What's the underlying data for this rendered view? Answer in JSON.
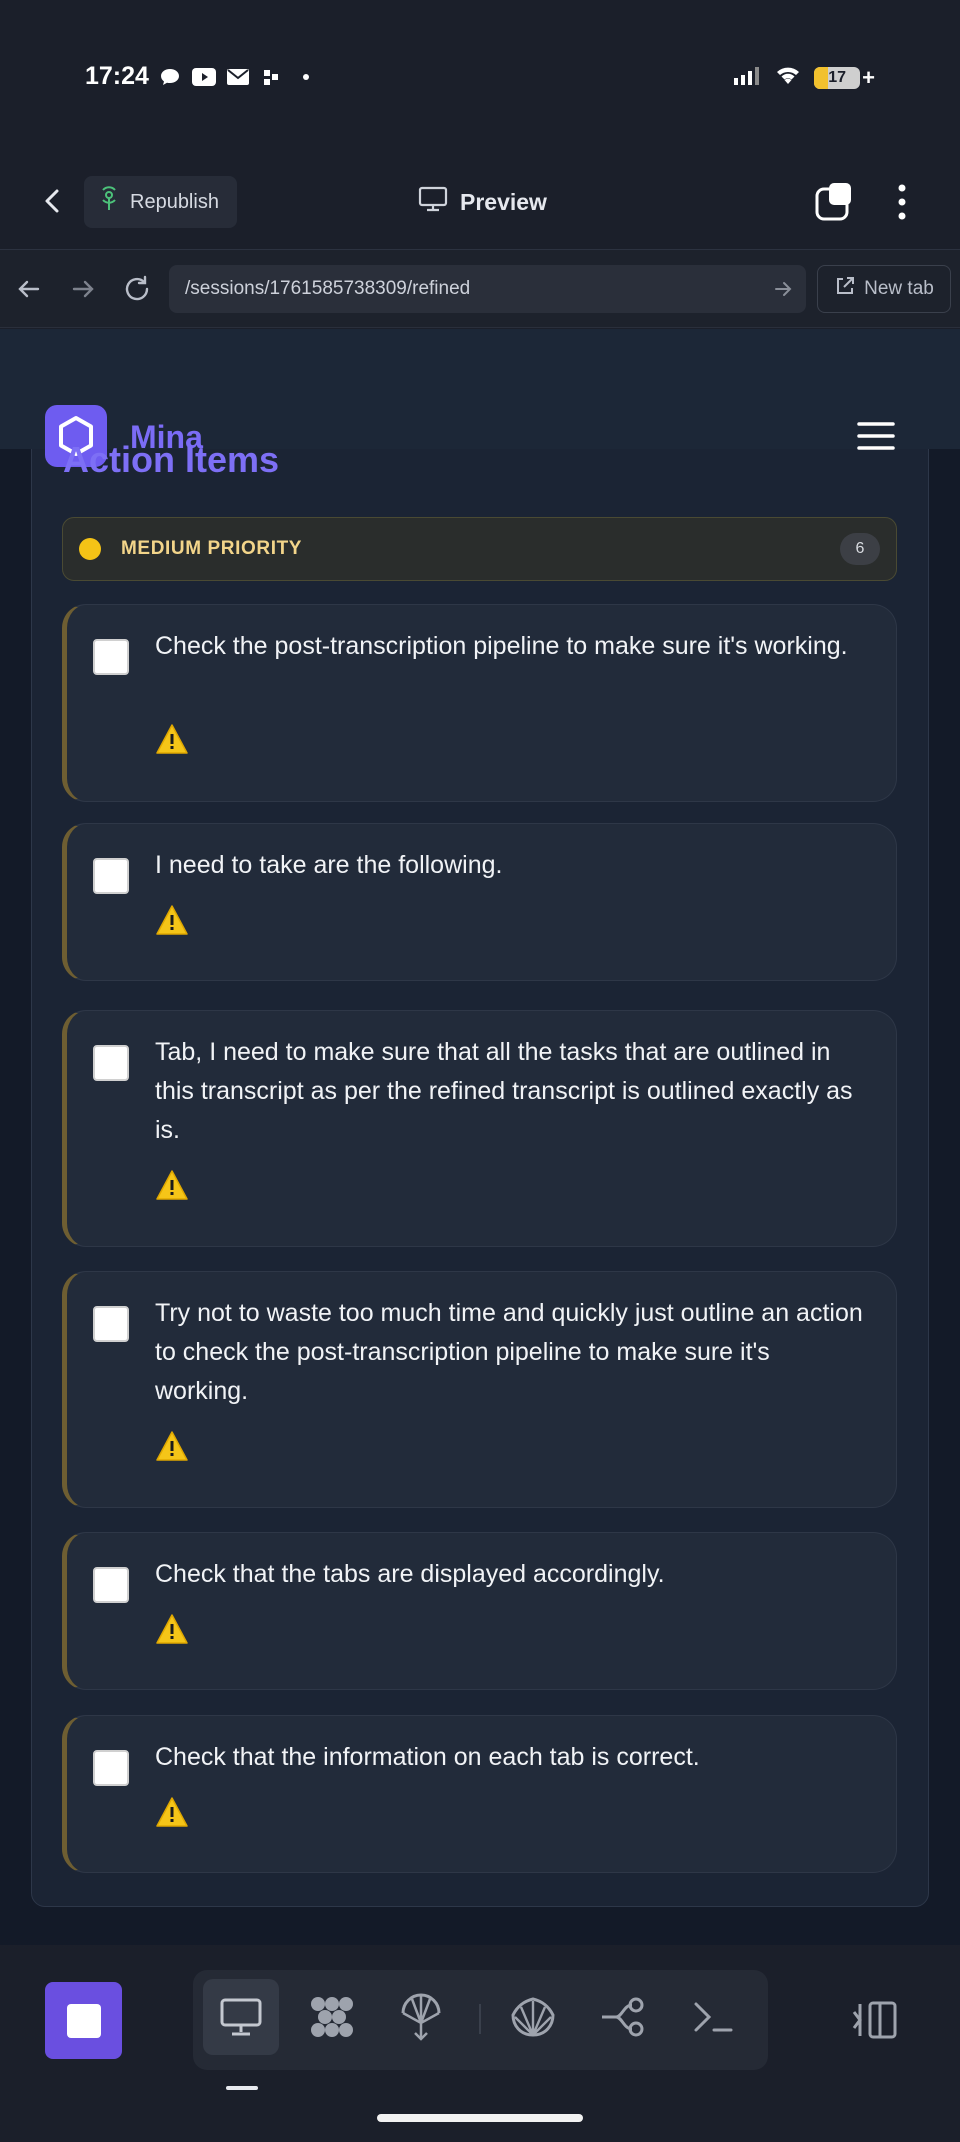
{
  "status_bar": {
    "time": "17:24",
    "battery": "17",
    "notification_icons": [
      "chat-bubble-icon",
      "youtube-icon",
      "mail-icon",
      "dots-icon"
    ]
  },
  "app_header": {
    "republish_label": "Republish",
    "preview_label": "Preview"
  },
  "url_bar": {
    "url": "/sessions/1761585738309/refined",
    "new_tab_label": "New tab"
  },
  "site": {
    "name": "Mina"
  },
  "section": {
    "title": "Action Items",
    "priority_label": "MEDIUM PRIORITY",
    "priority_count": "6",
    "colors": {
      "accent": "#7d6ff5",
      "priority_dot": "#f4c316",
      "priority_text": "#f3d58a"
    }
  },
  "items": [
    {
      "text": "Check the post-transcription pipeline to make sure it's working.",
      "checked": false,
      "icon": "warning-icon"
    },
    {
      "text": "I need to take are the following.",
      "checked": false,
      "icon": "warning-icon"
    },
    {
      "text": "Tab, I need to make sure that all the tasks that are outlined in this transcript as per the refined transcript is outlined exactly as is.",
      "checked": false,
      "icon": "warning-icon"
    },
    {
      "text": "Try not to waste too much time and quickly just outline an action to check the post-transcription pipeline to make sure it's working.",
      "checked": false,
      "icon": "warning-icon"
    },
    {
      "text": "Check that the tabs are displayed accordingly.",
      "checked": false,
      "icon": "warning-icon"
    },
    {
      "text": "Check that the information on each tab is correct.",
      "checked": false,
      "icon": "warning-icon"
    }
  ],
  "toolbar": {
    "tools": [
      "monitor-icon",
      "grid-blob-icon",
      "umbrella-icon",
      "shell-icon",
      "branch-icon",
      "terminal-icon"
    ],
    "active_tool": "monitor-icon"
  }
}
